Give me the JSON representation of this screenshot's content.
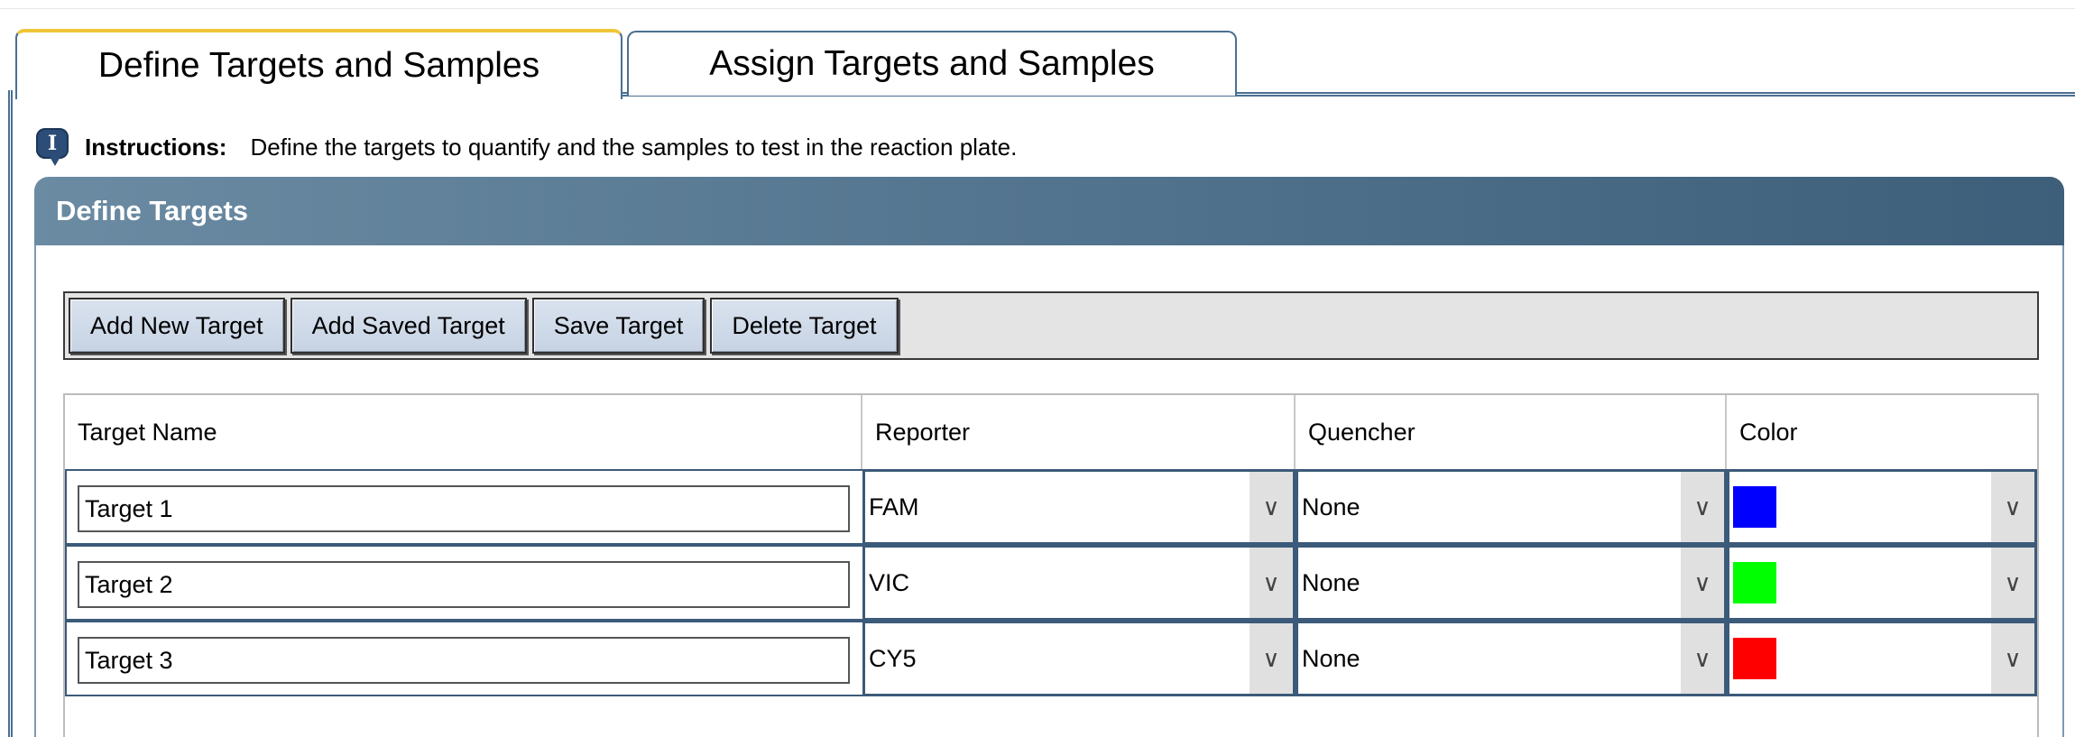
{
  "tabs": [
    {
      "label": "Define Targets and Samples",
      "active": true
    },
    {
      "label": "Assign Targets and Samples",
      "active": false
    }
  ],
  "instructions": {
    "icon": "info-i-icon",
    "icon_glyph": "I",
    "label": "Instructions:",
    "text": "Define the targets to quantify and the samples to test in the reaction plate."
  },
  "panel": {
    "title": "Define Targets"
  },
  "toolbar": {
    "add_new": "Add New Target",
    "add_saved": "Add Saved Target",
    "save": "Save Target",
    "delete": "Delete Target"
  },
  "table": {
    "columns": [
      "Target Name",
      "Reporter",
      "Quencher",
      "Color"
    ],
    "rows": [
      {
        "name": "Target 1",
        "reporter": "FAM",
        "quencher": "None",
        "color": "#0000ff"
      },
      {
        "name": "Target 2",
        "reporter": "VIC",
        "quencher": "None",
        "color": "#00ff00"
      },
      {
        "name": "Target 3",
        "reporter": "CY5",
        "quencher": "None",
        "color": "#ff0000"
      }
    ]
  },
  "colors": {
    "tab_border": "#4a6f93",
    "tab_active_accent": "#f0c53a",
    "header_gradient_start": "#6b8ba3",
    "header_gradient_end": "#3d5f7a",
    "button_face": "#c7d3e4"
  }
}
